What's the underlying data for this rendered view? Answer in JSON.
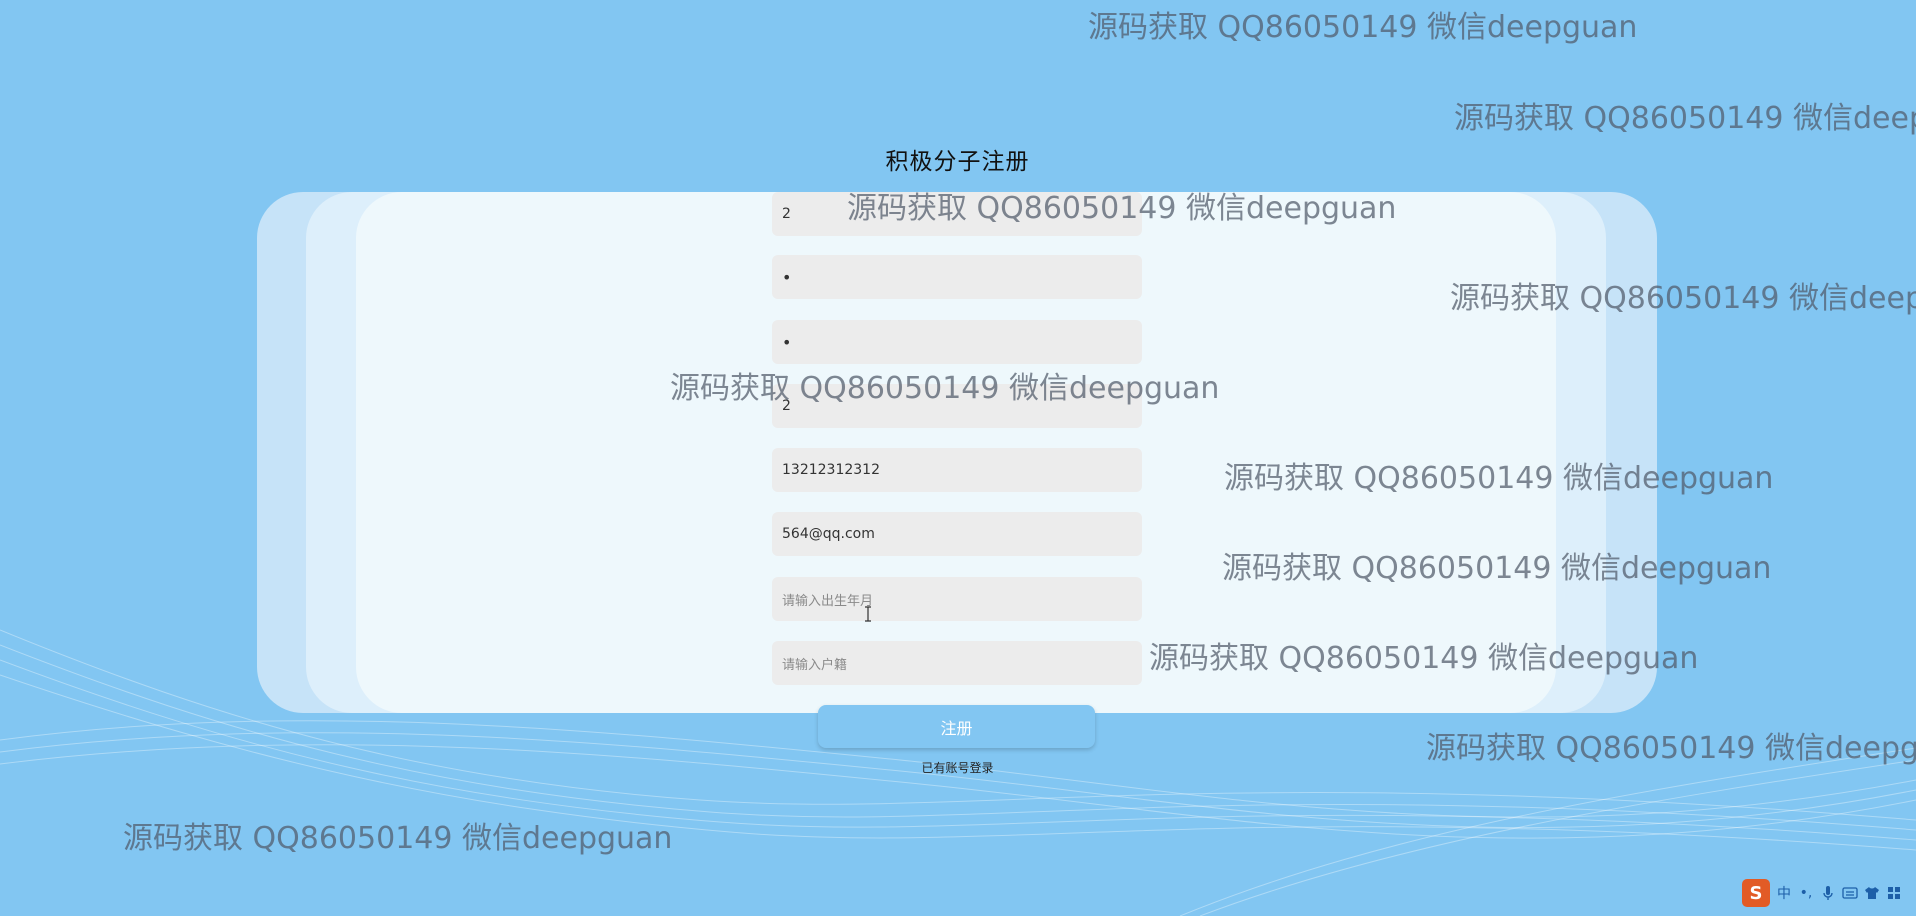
{
  "page": {
    "title": "积极分子注册"
  },
  "form": {
    "fields": [
      {
        "name": "username-field",
        "value": "2",
        "placeholder": "",
        "type": "text"
      },
      {
        "name": "password-field",
        "value": "•",
        "placeholder": "",
        "type": "password"
      },
      {
        "name": "confirm-password-field",
        "value": "•",
        "placeholder": "",
        "type": "password"
      },
      {
        "name": "name-field",
        "value": "2",
        "placeholder": "",
        "type": "text"
      },
      {
        "name": "phone-field",
        "value": "13212312312",
        "placeholder": "",
        "type": "text"
      },
      {
        "name": "email-field",
        "value": "564@qq.com",
        "placeholder": "",
        "type": "text"
      },
      {
        "name": "birthdate-field",
        "value": "",
        "placeholder": "请输入出生年月",
        "type": "text"
      },
      {
        "name": "hometown-field",
        "value": "",
        "placeholder": "请输入户籍",
        "type": "text"
      }
    ],
    "submit_label": "注册",
    "login_link_label": "已有账号登录"
  },
  "watermarks": [
    "源码获取 QQ86050149 微信deepguan",
    "源码获取 QQ86050149 微信deepguan",
    "源码获取 QQ86050149 微信deepguan",
    "源码获取 QQ86050149 微信deepguan",
    "源码获取 QQ86050149 微信deepguan",
    "源码获取 QQ86050149 微信deepguan",
    "源码获取 QQ86050149 微信deepguan",
    "源码获取 QQ86050149 微信deepguan",
    "源码获取 QQ86050149 微信deepguan",
    "源码获取 QQ86050149 微信deepguan"
  ],
  "taskbar": {
    "ime_logo": "S",
    "ime_language": "中",
    "punctuation_mode": "•,",
    "icons": [
      "microphone-icon",
      "keyboard-icon",
      "shirt-icon",
      "grid-icon"
    ]
  },
  "colors": {
    "background": "#82c6f2",
    "card_outer": "#c6e3f8",
    "card_middle": "#ddeffb",
    "card_inner": "#eef8fc",
    "input_bg": "#ececec",
    "button": "#82c6f2",
    "ime_brand": "#e25b26"
  }
}
